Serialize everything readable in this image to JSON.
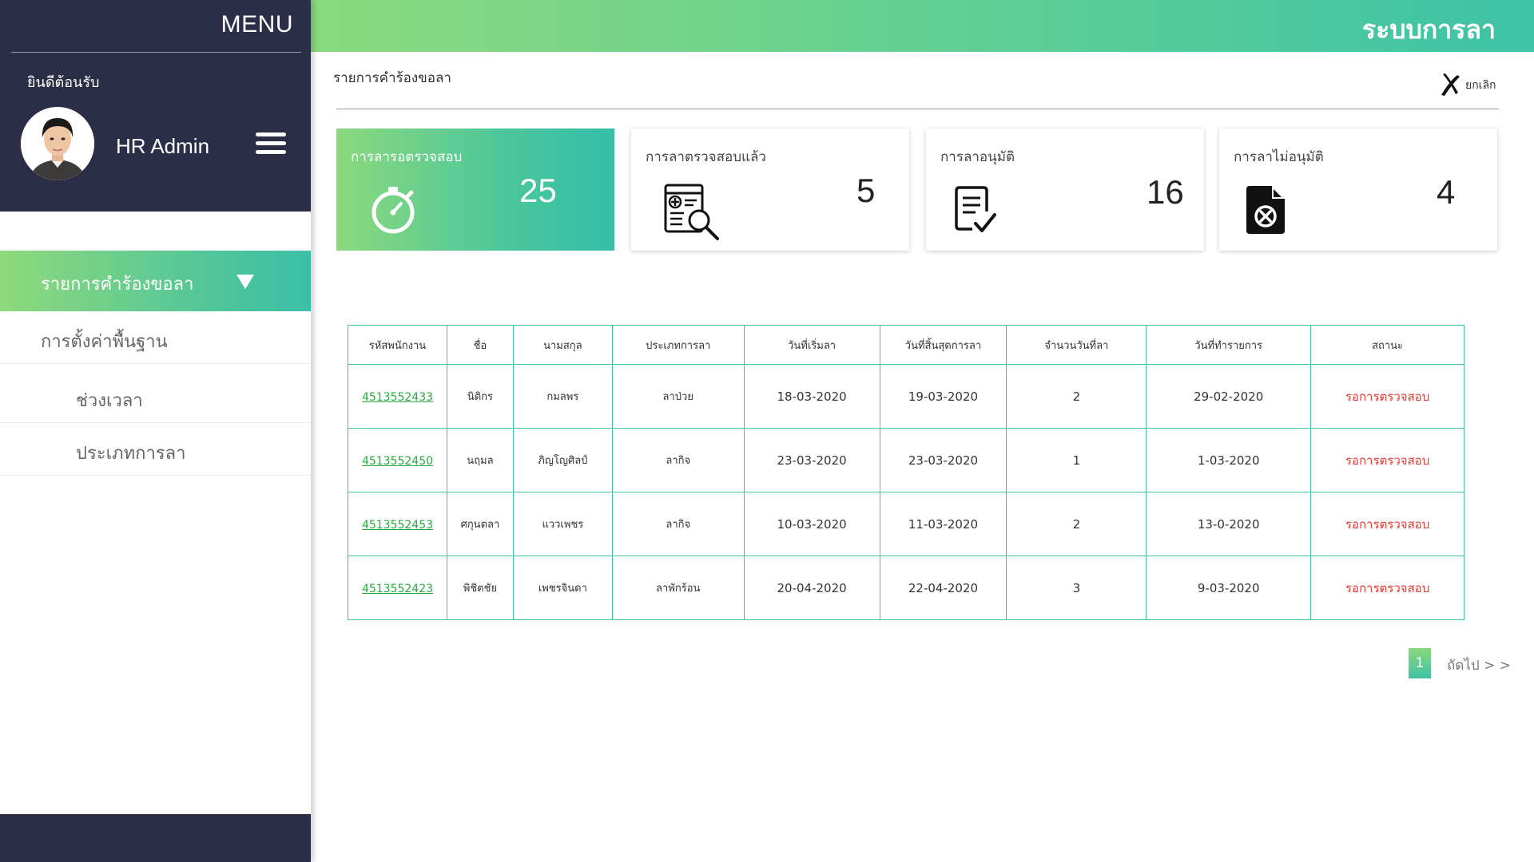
{
  "sidebar": {
    "menu_title": "MENU",
    "welcome": "ยินดีต้อนรับ",
    "user_name": "HR Admin",
    "items": [
      {
        "label": "รายการคำร้องขอลา"
      },
      {
        "label": "การตั้งค่าพื้นฐาน"
      },
      {
        "label": "ช่วงเวลา"
      },
      {
        "label": "ประเภทการลา"
      }
    ]
  },
  "header": {
    "app_title": "ระบบการลา"
  },
  "page": {
    "title": "รายการคำร้องขอลา",
    "cancel_label": "ยกเลิก"
  },
  "cards": [
    {
      "title": "การลารอตรวจสอบ",
      "value": "25",
      "icon": "stopwatch-icon"
    },
    {
      "title": "การลาตรวจสอบแล้ว",
      "value": "5",
      "icon": "document-search-icon"
    },
    {
      "title": "การลาอนุมัติ",
      "value": "16",
      "icon": "document-check-icon"
    },
    {
      "title": "การลาไม่อนุมัติ",
      "value": "4",
      "icon": "document-cancel-icon"
    }
  ],
  "table": {
    "headers": [
      "รหัสพนักงาน",
      "ชื่อ",
      "นามสกุล",
      "ประเภทการลา",
      "วันที่เริ่มลา",
      "วันที่สิ้นสุดการลา",
      "จำนวนวันที่ลา",
      "วันที่ทำรายการ",
      "สถานะ"
    ],
    "rows": [
      [
        "4513552433",
        "นิติกร",
        "กมลพร",
        "ลาป่วย",
        "18-03-2020",
        "19-03-2020",
        "2",
        "29-02-2020",
        "รอการตรวจสอบ"
      ],
      [
        "4513552450",
        "นฤมล",
        "ภิญโญศิลป์",
        "ลากิจ",
        "23-03-2020",
        "23-03-2020",
        "1",
        "1-03-2020",
        "รอการตรวจสอบ"
      ],
      [
        "4513552453",
        "ศกุนตลา",
        "แววเพชร",
        "ลากิจ",
        "10-03-2020",
        "11-03-2020",
        "2",
        "13-0-2020",
        "รอการตรวจสอบ"
      ],
      [
        "4513552423",
        "พิชิตชัย",
        "เพชรจินดา",
        "ลาพักร้อน",
        "20-04-2020",
        "22-04-2020",
        "3",
        "9-03-2020",
        "รอการตรวจสอบ"
      ]
    ]
  },
  "pagination": {
    "current": "1",
    "next_label": "ถัดไป > >"
  },
  "colors": {
    "accent_start": "#8bd97d",
    "accent_end": "#3ec1a5",
    "sidebar_dark": "#2c2e48",
    "status_pending": "#e53935",
    "link": "#27a93d"
  }
}
